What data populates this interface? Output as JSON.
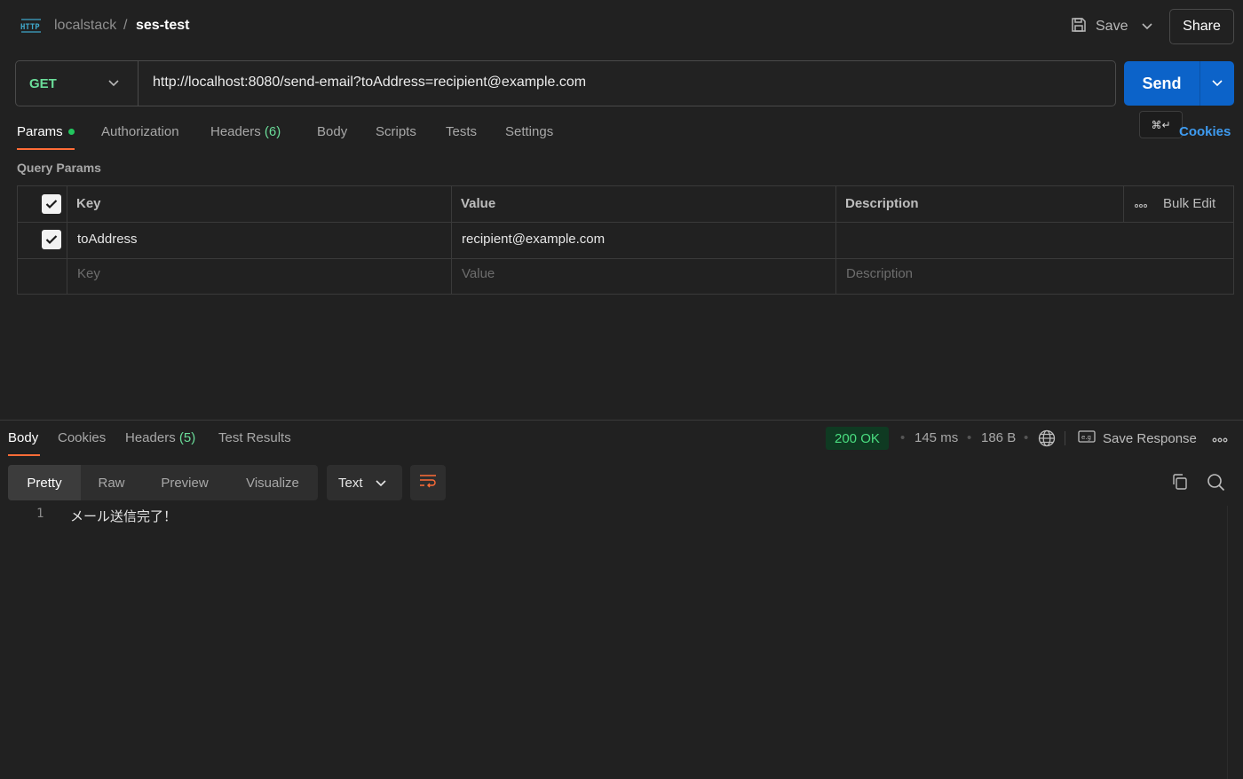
{
  "header": {
    "icon": "http-icon",
    "breadcrumb_parent": "localstack",
    "breadcrumb_sep": "/",
    "breadcrumb_current": "ses-test",
    "save_label": "Save",
    "share_label": "Share"
  },
  "request": {
    "method": "GET",
    "url": "http://localhost:8080/send-email?toAddress=recipient@example.com",
    "send_label": "Send",
    "shortcut_tooltip": "⌘↵"
  },
  "request_tabs": {
    "params": "Params",
    "authorization": "Authorization",
    "headers": "Headers",
    "headers_count": "(6)",
    "body": "Body",
    "scripts": "Scripts",
    "tests": "Tests",
    "settings": "Settings",
    "cookies": "Cookies"
  },
  "params": {
    "section_title": "Query Params",
    "columns": {
      "key": "Key",
      "value": "Value",
      "description": "Description"
    },
    "bulk_edit": "Bulk Edit",
    "rows": [
      {
        "enabled": true,
        "key": "toAddress",
        "value": "recipient@example.com",
        "description": ""
      }
    ],
    "placeholders": {
      "key": "Key",
      "value": "Value",
      "description": "Description"
    }
  },
  "response": {
    "tabs": {
      "body": "Body",
      "cookies": "Cookies",
      "headers": "Headers",
      "headers_count": "(5)",
      "test_results": "Test Results"
    },
    "status": "200 OK",
    "time": "145 ms",
    "size": "186 B",
    "save_response": "Save Response",
    "views": {
      "pretty": "Pretty",
      "raw": "Raw",
      "preview": "Preview",
      "visualize": "Visualize"
    },
    "format": "Text",
    "lines": [
      {
        "no": "1",
        "text": "メール送信完了！"
      }
    ]
  },
  "colors": {
    "accent_orange": "#ff6c37",
    "send_blue": "#0c63c9",
    "method_green": "#6bdd9a",
    "status_green": "#4ade80"
  }
}
